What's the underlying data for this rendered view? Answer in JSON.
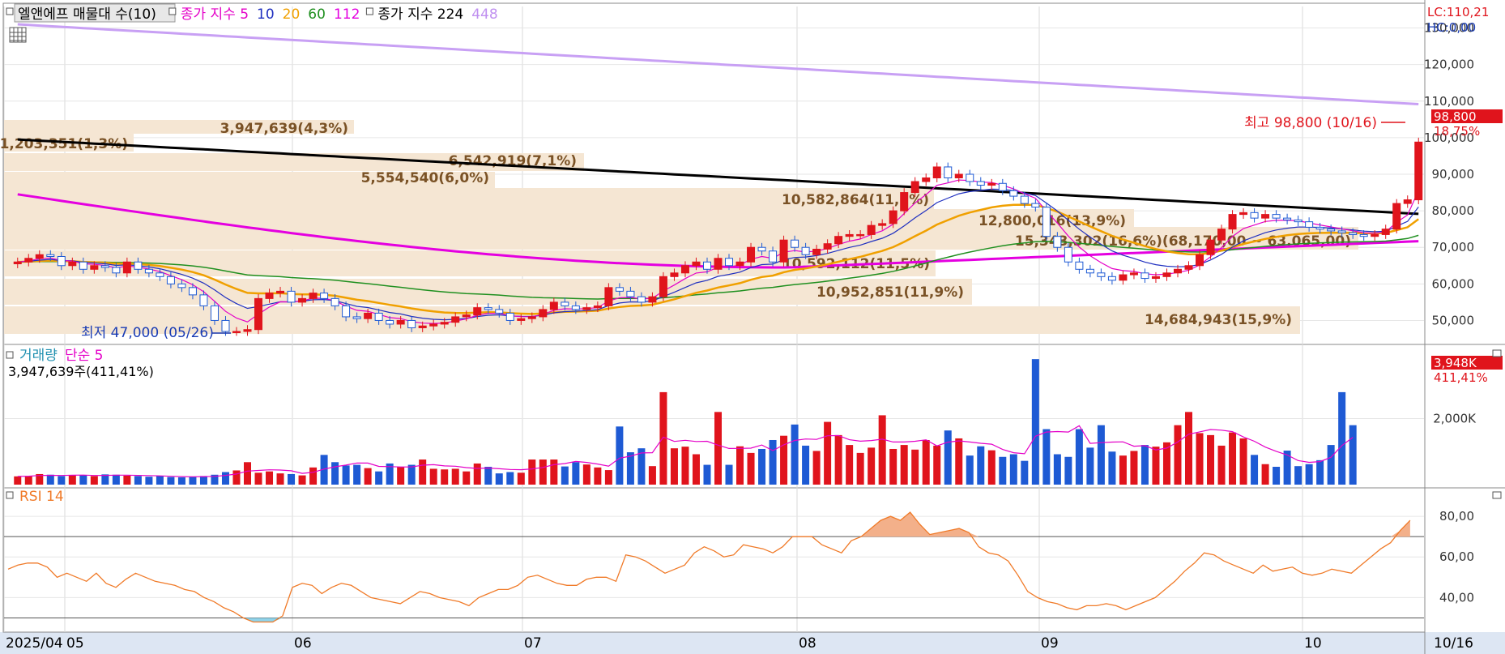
{
  "price_panel": {
    "legend": [
      {
        "text": "엘앤에프 매물대 수(10)",
        "color": "#000000"
      },
      {
        "text": "종가 지수 5",
        "color": "#e400c8"
      },
      {
        "text": "10",
        "color": "#2030c0"
      },
      {
        "text": "20",
        "color": "#f0a000"
      },
      {
        "text": "60",
        "color": "#209020"
      },
      {
        "text": "112",
        "color": "#e400e0"
      },
      {
        "text": "종가 지수 224",
        "color": "#000000"
      },
      {
        "text": "448",
        "color": "#c090f0"
      }
    ],
    "lc_label": "LC:110,21",
    "hc_label": "HC:0,00",
    "y_ticks": [
      "130,000",
      "120,000",
      "110,000",
      "100,000",
      "90,000",
      "80,000",
      "70,000",
      "60,000",
      "50,000"
    ],
    "current_price_tag": "98,800",
    "current_change_tag": "18,75%",
    "high_annotation": "최고 98,800 (10/16)",
    "low_annotation": "최저 47,000 (05/26)",
    "volume_profile": [
      {
        "label": "14,684,943(15,9%)",
        "pct": 15.9
      },
      {
        "label": "10,952,851(11,9%)",
        "pct": 11.9
      },
      {
        "label": "10,592,112(11,5%)",
        "pct": 11.5
      },
      {
        "label": "15,343,302(16,6%)(68,170,00 ~ 63,065,00)",
        "pct": 16.6
      },
      {
        "label": "12,800,016(13,9%)",
        "pct": 13.9
      },
      {
        "label": "10,582,864(11,5%)",
        "pct": 11.5
      },
      {
        "label": "5,554,540(6,0%)",
        "pct": 6.0
      },
      {
        "label": "6,542,919(7,1%)",
        "pct": 7.1
      },
      {
        "label": "1,203,351(1,3%)",
        "pct": 1.3
      },
      {
        "label": "3,947,639(4,3%)",
        "pct": 4.3
      }
    ]
  },
  "volume_panel": {
    "title": "거래량",
    "ma_label": "단순 5",
    "value_text": "3,947,639주(411,41%)",
    "y_tick": "2,000K",
    "current_tag": "3,948K",
    "current_pct_tag": "411,41%"
  },
  "rsi_panel": {
    "title": "RSI 14",
    "y_ticks": [
      "80,00",
      "60,00",
      "40,00"
    ]
  },
  "x_axis": {
    "labels": [
      "2025/04",
      "05",
      "06",
      "07",
      "08",
      "09",
      "10"
    ],
    "last_date": "10/16"
  },
  "chart_data": [
    {
      "type": "candlestick",
      "title": "엘앤에프",
      "ylim": [
        45000,
        135000
      ],
      "close_values": [
        66000,
        67000,
        68000,
        67500,
        65000,
        66000,
        64000,
        65000,
        64500,
        63000,
        66000,
        64000,
        63000,
        62000,
        60000,
        59000,
        57000,
        54000,
        50000,
        47000,
        47000,
        47500,
        56000,
        57500,
        58000,
        55000,
        56000,
        57500,
        56000,
        54000,
        51000,
        50500,
        52000,
        50000,
        49000,
        50000,
        48000,
        48500,
        49000,
        49500,
        51000,
        51500,
        53500,
        53000,
        52000,
        50000,
        50500,
        51000,
        53000,
        55000,
        54000,
        53000,
        53500,
        54000,
        59000,
        58000,
        56500,
        55000,
        56500,
        62000,
        63000,
        65000,
        66000,
        64000,
        67000,
        65000,
        66000,
        70000,
        69000,
        66000,
        72000,
        70000,
        68000,
        69500,
        71000,
        73000,
        73500,
        73500,
        76000,
        76500,
        80000,
        85000,
        88000,
        89000,
        92000,
        89000,
        90000,
        88000,
        87000,
        87500,
        85500,
        84000,
        82000,
        81000,
        73000,
        70000,
        66000,
        64000,
        63000,
        62000,
        61000,
        62500,
        63000,
        61500,
        62000,
        63000,
        64000,
        65000,
        68000,
        72000,
        75000,
        79000,
        79500,
        78000,
        79000,
        78000,
        77500,
        77000,
        75500,
        75000,
        74500,
        74000,
        73500,
        73000,
        73500,
        75000,
        82000,
        83000,
        98800
      ],
      "indicators": [
        "종가 지수 5",
        "10",
        "20",
        "60",
        "112",
        "종가 지수 224",
        "448"
      ]
    },
    {
      "type": "bar",
      "title": "거래량",
      "ylim": [
        0,
        4000
      ],
      "unit": "K",
      "values": [
        250,
        260,
        320,
        300,
        260,
        280,
        290,
        260,
        310,
        300,
        270,
        260,
        240,
        260,
        230,
        220,
        240,
        260,
        300,
        380,
        430,
        680,
        360,
        400,
        340,
        320,
        280,
        520,
        900,
        680,
        580,
        600,
        500,
        400,
        640,
        540,
        600,
        760,
        480,
        460,
        480,
        400,
        640,
        540,
        340,
        380,
        360,
        760,
        760,
        760,
        550,
        680,
        610,
        520,
        440,
        1760,
        980,
        1100,
        560,
        2800,
        1100,
        1150,
        920,
        600,
        2200,
        600,
        1160,
        960,
        1080,
        1350,
        1480,
        1820,
        1180,
        1020,
        1900,
        1500,
        1200,
        960,
        1120,
        2100,
        1080,
        1200,
        1060,
        1350,
        1180,
        1640,
        1400,
        880,
        1160,
        1040,
        840,
        920,
        720,
        3800,
        1680,
        920,
        840,
        1680,
        1120,
        1800,
        1000,
        880,
        1020,
        1200,
        1150,
        1280,
        1800,
        2200,
        1560,
        1500,
        1180,
        1580,
        1400,
        900,
        620,
        540,
        1030,
        560,
        620,
        740,
        1200,
        2800,
        1800
      ],
      "ma_label": "단순 5"
    },
    {
      "type": "line",
      "title": "RSI 14",
      "ylim": [
        25,
        90
      ],
      "y_ticks": [
        80,
        60,
        40
      ],
      "values": [
        54,
        56,
        57,
        57,
        55,
        50,
        52,
        50,
        48,
        52,
        47,
        45,
        49,
        52,
        50,
        48,
        47,
        46,
        44,
        43,
        40,
        38,
        35,
        33,
        30,
        28,
        28,
        28,
        31,
        45,
        47,
        46,
        42,
        45,
        47,
        46,
        43,
        40,
        39,
        38,
        37,
        40,
        43,
        42,
        40,
        39,
        38,
        36,
        40,
        42,
        44,
        44,
        46,
        50,
        51,
        49,
        47,
        46,
        46,
        49,
        50,
        50,
        48,
        61,
        60,
        58,
        55,
        52,
        54,
        56,
        62,
        65,
        63,
        60,
        61,
        66,
        65,
        64,
        62,
        65,
        70,
        70,
        70,
        66,
        64,
        62,
        68,
        70,
        74,
        78,
        80,
        78,
        82,
        76,
        71,
        72,
        73,
        74,
        72,
        65,
        62,
        61,
        58,
        51,
        43,
        40,
        38,
        37,
        35,
        34,
        36,
        36,
        37,
        36,
        34,
        36,
        38,
        40,
        44,
        48,
        53,
        57,
        62,
        61,
        58,
        56,
        54,
        52,
        56,
        53,
        54,
        55,
        52,
        51,
        52,
        54,
        53,
        52,
        56,
        60,
        64,
        67,
        73,
        78
      ]
    }
  ]
}
